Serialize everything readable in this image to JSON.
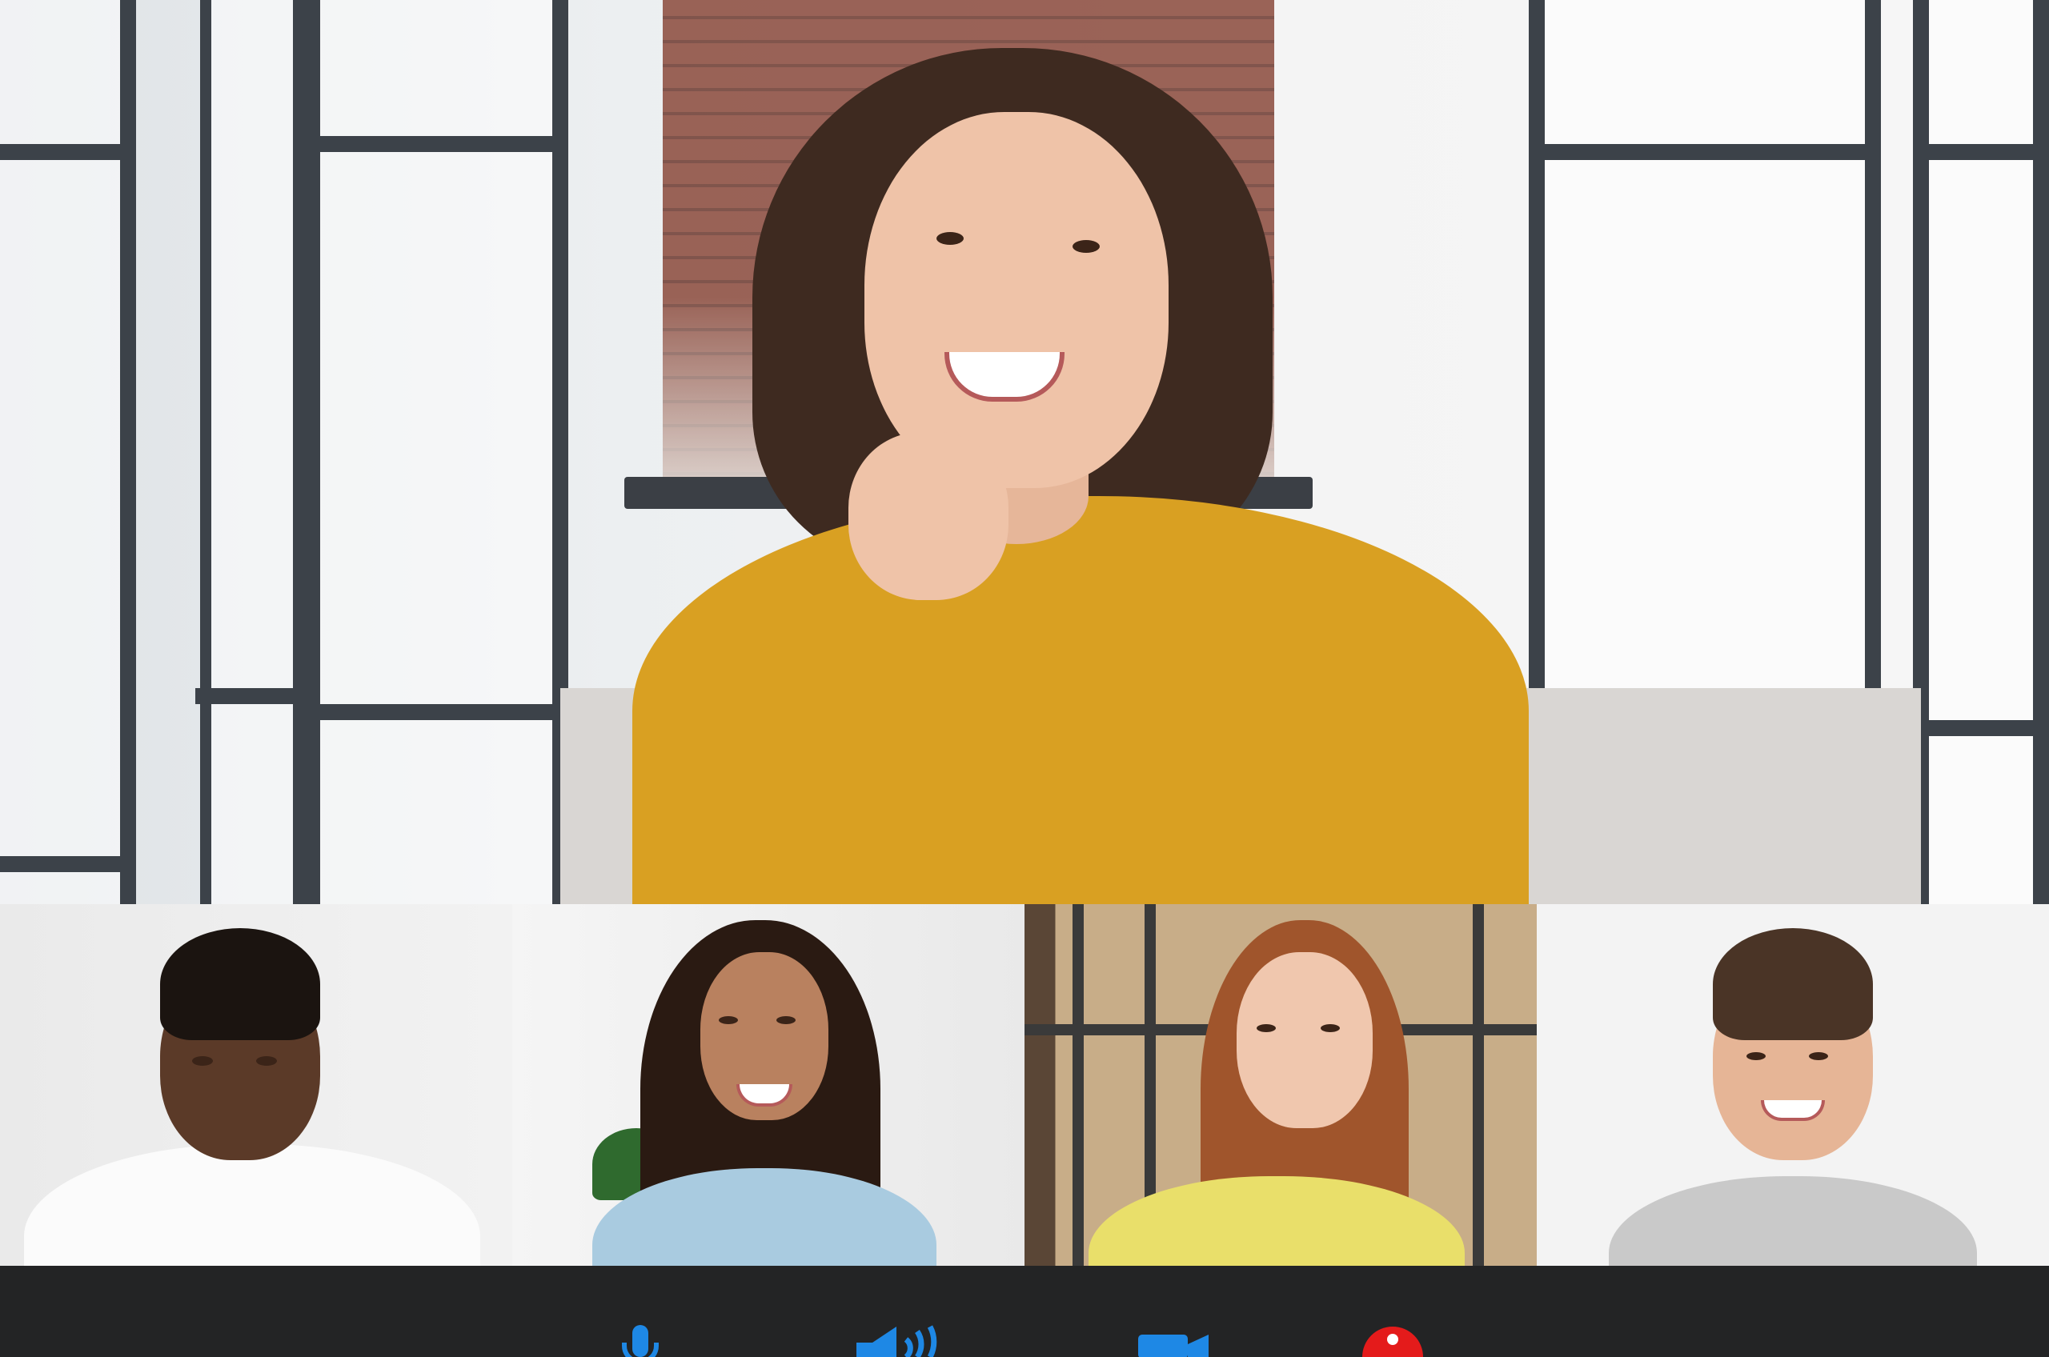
{
  "app": {
    "type": "video-call"
  },
  "main_speaker": {
    "video": "speaker-video"
  },
  "participants": [
    {
      "id": "participant-1",
      "video": "participant-video"
    },
    {
      "id": "participant-2",
      "video": "participant-video"
    },
    {
      "id": "participant-3",
      "video": "participant-video"
    },
    {
      "id": "participant-4",
      "video": "participant-video"
    }
  ],
  "controls": [
    {
      "name": "microphone",
      "icon": "microphone-icon",
      "color": "#1e88e5"
    },
    {
      "name": "speaker",
      "icon": "speaker-volume-icon",
      "color": "#1e88e5"
    },
    {
      "name": "camera",
      "icon": "video-camera-icon",
      "color": "#1e88e5"
    },
    {
      "name": "end-call",
      "icon": "end-call-icon",
      "color": "#e41b1b"
    }
  ],
  "colors": {
    "control_bar": "#232425",
    "accent": "#1e88e5",
    "danger": "#e41b1b"
  }
}
